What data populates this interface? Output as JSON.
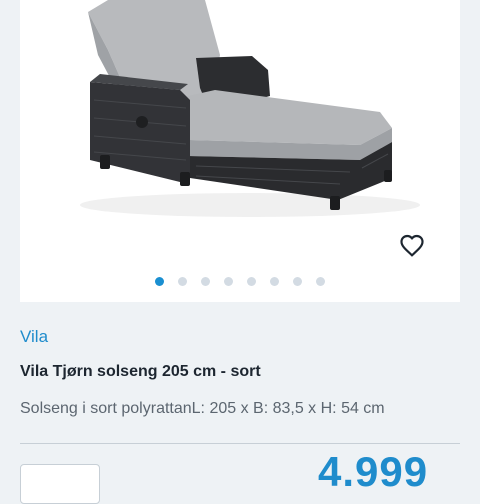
{
  "product": {
    "image_alt": "Vila Tjørn solseng",
    "brand": "Vila",
    "title": "Vila Tjørn solseng 205 cm - sort",
    "description": "Solseng i sort polyrattanL: 205 x B: 83,5 x H: 54 cm",
    "price": "4.999",
    "favorite_icon": "heart-outline-icon"
  },
  "carousel": {
    "total": 8,
    "active_index": 0
  },
  "colors": {
    "accent": "#1f8ccc",
    "dot_active": "#1a8fd1",
    "dot_inactive": "#d3dbe3",
    "background": "#eef2f5"
  }
}
